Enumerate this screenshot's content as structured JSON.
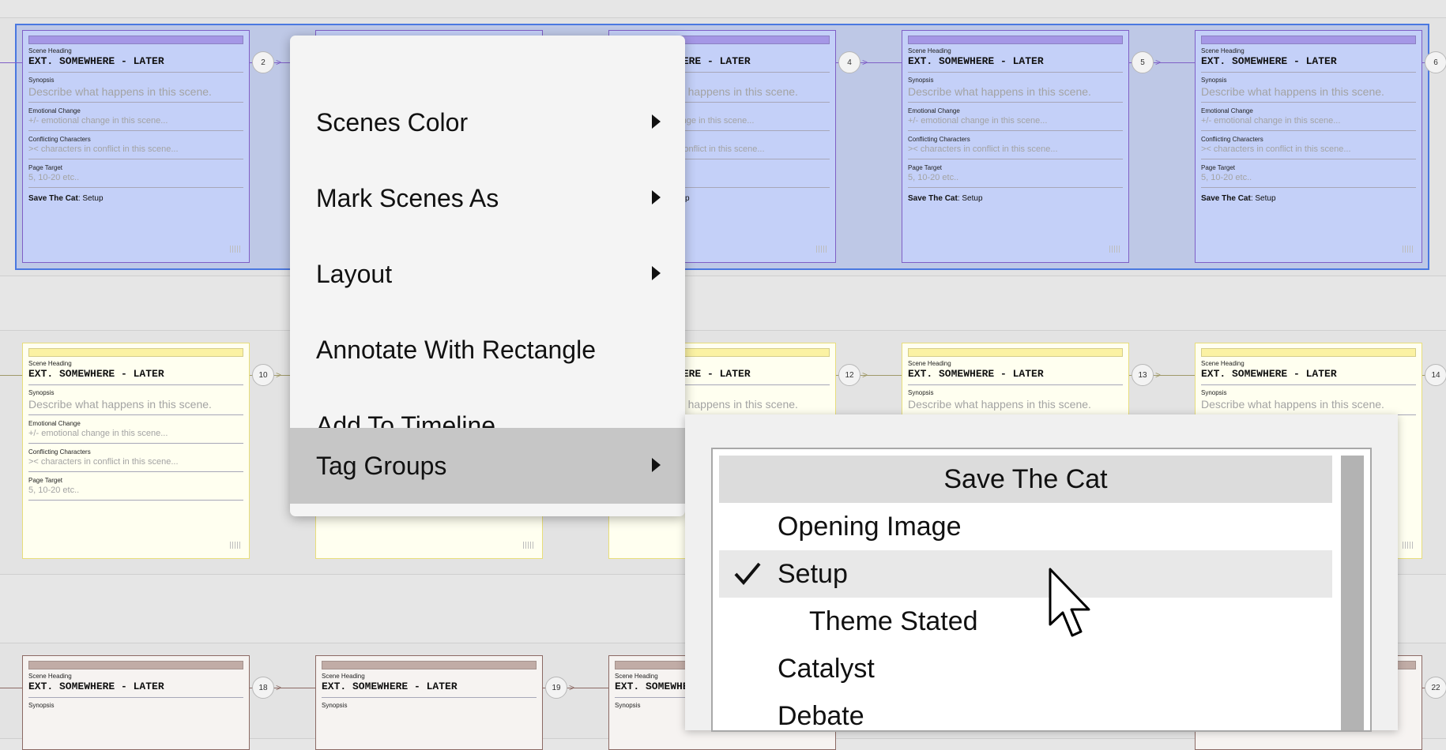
{
  "card_fields": {
    "heading_label": "Scene Heading",
    "heading_value": "EXT. SOMEWHERE - LATER",
    "synopsis_label": "Synopsis",
    "synopsis_placeholder": "Describe what happens in this scene.",
    "emotional_label": "Emotional Change",
    "emotional_placeholder": "+/- emotional change in this scene...",
    "conflict_label": "Conflicting Characters",
    "conflict_placeholder": ">< characters in conflict in this scene...",
    "page_label": "Page Target",
    "page_placeholder": "5, 10-20 etc..",
    "stc_label": "Save The Cat",
    "stc_value": "Setup"
  },
  "row_colors": {
    "row1_fill": "#c4d0f8",
    "row1_border": "#7f5fc6",
    "row1_bar": "#a597e6",
    "row2_fill": "#fffff0",
    "row2_border": "#e8de7a",
    "row2_bar": "#fbf2a3",
    "row3_fill": "#f6f3f1",
    "row3_border": "#8c6a64",
    "row3_bar": "#c1aca6",
    "selection": "#4a78e0"
  },
  "badges": {
    "b2": "2",
    "b4": "4",
    "b5": "5",
    "b6": "6",
    "b10": "10",
    "b12": "12",
    "b13": "13",
    "b14": "14",
    "b18": "18",
    "b19": "19",
    "b22": "22"
  },
  "context_menu": {
    "items": [
      {
        "label": "Scenes Color",
        "has_submenu": true,
        "icon": "triangle-right-icon"
      },
      {
        "label": "Mark Scenes As",
        "has_submenu": true,
        "icon": "triangle-right-icon"
      },
      {
        "label": "Layout",
        "has_submenu": true,
        "icon": "triangle-right-icon"
      },
      {
        "label": "Annotate With Rectangle",
        "has_submenu": false
      },
      {
        "label": "Add To Timeline",
        "has_submenu": false
      },
      {
        "label": "Tag Groups",
        "has_submenu": true,
        "highlighted": true,
        "icon": "triangle-right-icon"
      }
    ]
  },
  "tag_groups_submenu": {
    "header": "Save The Cat",
    "items": [
      {
        "label": "Opening Image",
        "checked": false
      },
      {
        "label": "Setup",
        "checked": true,
        "check_icon": "checkmark-icon"
      },
      {
        "label": "Theme Stated",
        "checked": false,
        "indented": true
      },
      {
        "label": "Catalyst",
        "checked": false
      },
      {
        "label": "Debate",
        "checked": false
      }
    ]
  }
}
